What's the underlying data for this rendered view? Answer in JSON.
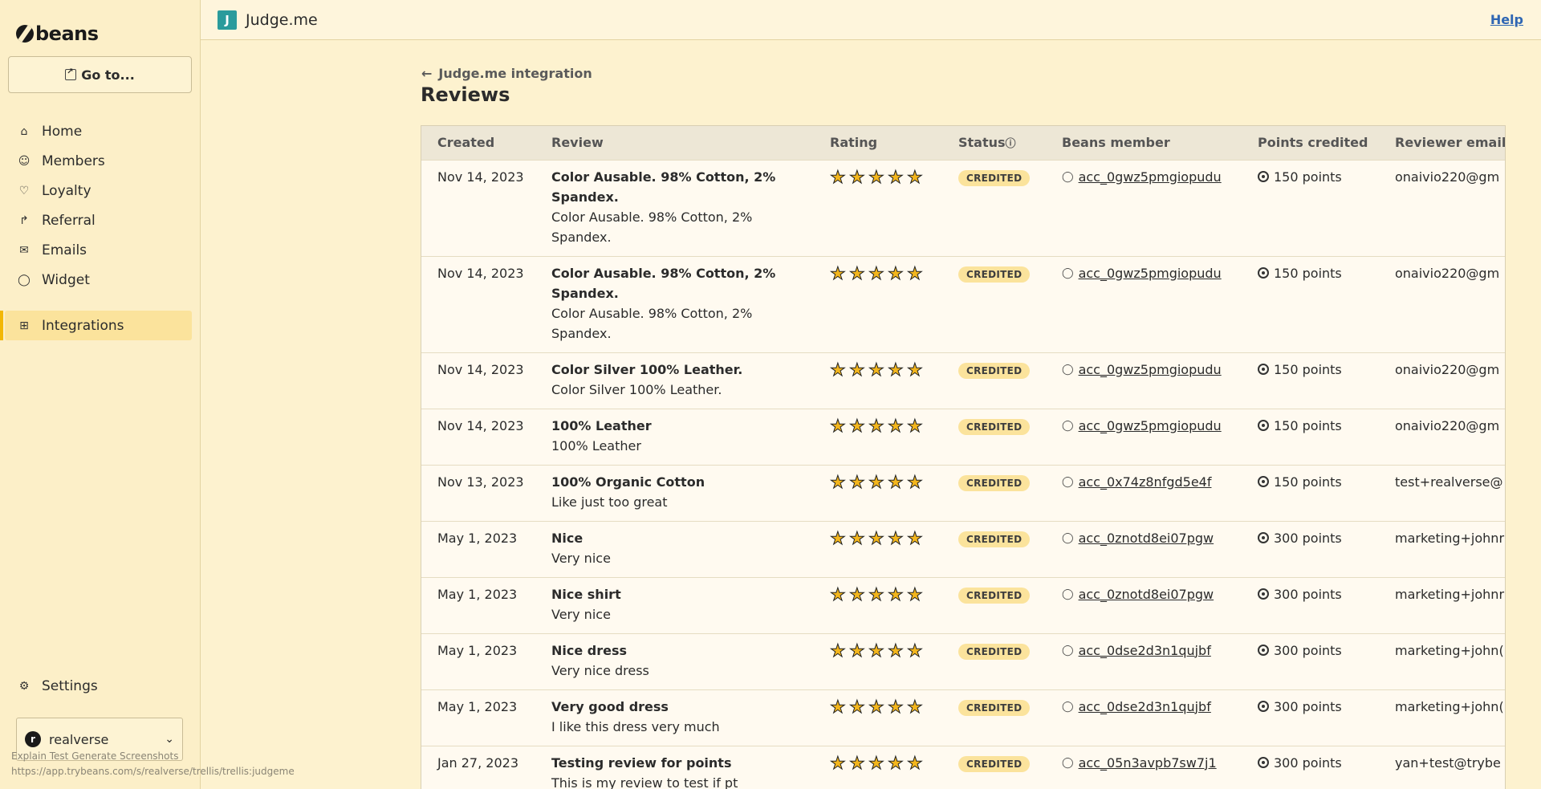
{
  "sidebar": {
    "logo": "beans",
    "goto_label": "Go to...",
    "items": [
      {
        "label": "Home",
        "icon": "home-icon"
      },
      {
        "label": "Members",
        "icon": "user-icon"
      },
      {
        "label": "Loyalty",
        "icon": "heart-icon"
      },
      {
        "label": "Referral",
        "icon": "share-icon"
      },
      {
        "label": "Emails",
        "icon": "mail-icon"
      },
      {
        "label": "Widget",
        "icon": "chat-icon"
      },
      {
        "label": "Integrations",
        "icon": "grid-icon",
        "active": true
      }
    ],
    "settings_label": "Settings",
    "account_name": "realverse",
    "account_initial": "r"
  },
  "statusbar": {
    "line1": "Explain Test Generate Screenshots",
    "line2": "https://app.trybeans.com/s/realverse/trellis/trellis:judgeme"
  },
  "topbar": {
    "app_initial": "J",
    "app_title": "Judge.me",
    "help_label": "Help"
  },
  "breadcrumb": {
    "back_label": "Judge.me integration"
  },
  "page_title": "Reviews",
  "table": {
    "headers": [
      "Created",
      "Review",
      "Rating",
      "Status",
      "Beans member",
      "Points credited",
      "Reviewer email"
    ],
    "rows": [
      {
        "created": "Nov 14, 2023",
        "title": "Color Ausable. 98% Cotton, 2% Spandex.",
        "body": "Color Ausable. 98% Cotton, 2% Spandex.",
        "rating": 5,
        "status": "CREDITED",
        "member": "acc_0gwz5pmgiopudu",
        "points": "150 points",
        "email": "onaivio220@gm"
      },
      {
        "created": "Nov 14, 2023",
        "title": "Color Ausable. 98% Cotton, 2% Spandex.",
        "body": "Color Ausable. 98% Cotton, 2% Spandex.",
        "rating": 5,
        "status": "CREDITED",
        "member": "acc_0gwz5pmgiopudu",
        "points": "150 points",
        "email": "onaivio220@gm"
      },
      {
        "created": "Nov 14, 2023",
        "title": "Color Silver 100% Leather.",
        "body": "Color Silver 100% Leather.",
        "rating": 5,
        "status": "CREDITED",
        "member": "acc_0gwz5pmgiopudu",
        "points": "150 points",
        "email": "onaivio220@gm"
      },
      {
        "created": "Nov 14, 2023",
        "title": "100% Leather",
        "body": "100% Leather",
        "rating": 5,
        "status": "CREDITED",
        "member": "acc_0gwz5pmgiopudu",
        "points": "150 points",
        "email": "onaivio220@gm"
      },
      {
        "created": "Nov 13, 2023",
        "title": "100% Organic Cotton",
        "body": "Like just too great",
        "rating": 5,
        "status": "CREDITED",
        "member": "acc_0x74z8nfgd5e4f",
        "points": "150 points",
        "email": "test+realverse@"
      },
      {
        "created": "May 1, 2023",
        "title": "Nice",
        "body": "Very nice",
        "rating": 5,
        "status": "CREDITED",
        "member": "acc_0znotd8ei07pgw",
        "points": "300 points",
        "email": "marketing+johnr"
      },
      {
        "created": "May 1, 2023",
        "title": "Nice shirt",
        "body": "Very nice",
        "rating": 5,
        "status": "CREDITED",
        "member": "acc_0znotd8ei07pgw",
        "points": "300 points",
        "email": "marketing+johnr"
      },
      {
        "created": "May 1, 2023",
        "title": "Nice dress",
        "body": "Very nice dress",
        "rating": 5,
        "status": "CREDITED",
        "member": "acc_0dse2d3n1qujbf",
        "points": "300 points",
        "email": "marketing+john("
      },
      {
        "created": "May 1, 2023",
        "title": "Very good dress",
        "body": "I like this dress very much",
        "rating": 5,
        "status": "CREDITED",
        "member": "acc_0dse2d3n1qujbf",
        "points": "300 points",
        "email": "marketing+john("
      },
      {
        "created": "Jan 27, 2023",
        "title": "Testing review for points",
        "body": "This is my review to test if pt",
        "rating": 5,
        "status": "CREDITED",
        "member": "acc_05n3avpb7sw7j1",
        "points": "300 points",
        "email": "yan+test@trybe"
      }
    ]
  }
}
